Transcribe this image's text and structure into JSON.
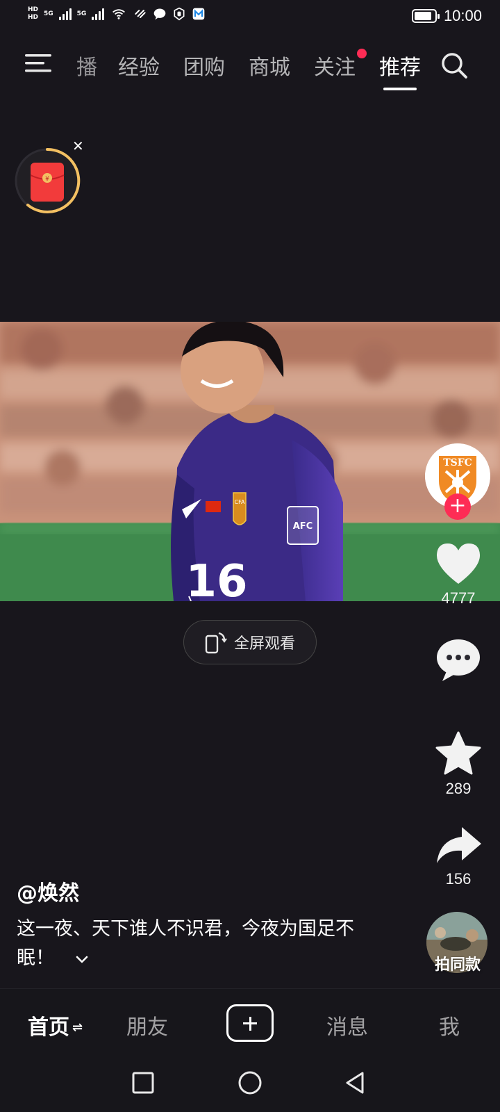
{
  "status_bar": {
    "left_tiny_1": "HD",
    "left_tiny_2": "5G",
    "left_tiny_3": "5G",
    "time": "10:00",
    "battery_level": 0.85
  },
  "top_nav": {
    "tabs": [
      {
        "label": "播",
        "active": false
      },
      {
        "label": "经验",
        "active": false
      },
      {
        "label": "团购",
        "active": false
      },
      {
        "label": "商城",
        "active": false
      },
      {
        "label": "关注",
        "active": false,
        "has_dot": true
      },
      {
        "label": "推荐",
        "active": true
      }
    ]
  },
  "video": {
    "jersey_number": "16",
    "badge_left": "CFA",
    "badge_right": "AFC",
    "crest": "TSFC"
  },
  "fullscreen": {
    "label": "全屏观看"
  },
  "rail": {
    "like_count": "4777",
    "favorite_count": "289",
    "share_count": "156",
    "same_style_label": "拍同款"
  },
  "caption": {
    "author": "@焕然",
    "description": "这一夜、天下谁人不识君，今夜为国足不眠！"
  },
  "bottom_tabs": {
    "home": "首页",
    "home_swap": "⇌",
    "friends": "朋友",
    "messages": "消息",
    "me": "我"
  },
  "colors": {
    "accent": "#fe2c55",
    "background": "#18161c",
    "jersey": "#3b2a86"
  }
}
